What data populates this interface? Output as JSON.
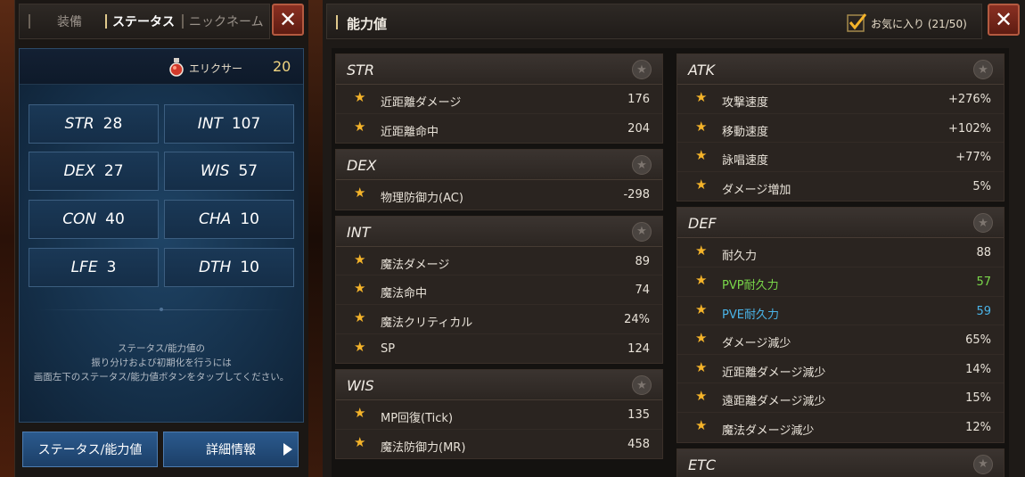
{
  "left": {
    "tabs": [
      {
        "label": "装備",
        "active": false
      },
      {
        "label": "ステータス",
        "active": true
      },
      {
        "label": "ニックネーム",
        "active": false
      }
    ],
    "close_label": "✕",
    "elixir": {
      "label": "エリクサー",
      "value": "20"
    },
    "stats": [
      {
        "name": "STR",
        "value": "28"
      },
      {
        "name": "INT",
        "value": "107"
      },
      {
        "name": "DEX",
        "value": "27"
      },
      {
        "name": "WIS",
        "value": "57"
      },
      {
        "name": "CON",
        "value": "40"
      },
      {
        "name": "CHA",
        "value": "10"
      },
      {
        "name": "LFE",
        "value": "3"
      },
      {
        "name": "DTH",
        "value": "10"
      }
    ],
    "note": [
      "ステータス/能力値の",
      "振り分けおよび初期化を行うには",
      "画面左下のステータス/能力値ボタンをタップしてください。"
    ],
    "buttons": {
      "status": "ステータス/能力値",
      "detail": "詳細情報"
    }
  },
  "right": {
    "title": "能力値",
    "favorite": "お気に入り (21/50)",
    "close_label": "✕",
    "colors": {
      "star": "#f5b42a",
      "pvp": "#7ad84a",
      "pve": "#4ab4e8"
    },
    "groups_left": [
      {
        "name": "STR",
        "rows": [
          {
            "label": "近距離ダメージ",
            "value": "176"
          },
          {
            "label": "近距離命中",
            "value": "204"
          }
        ]
      },
      {
        "name": "DEX",
        "rows": [
          {
            "label": "物理防御力(AC)",
            "value": "-298"
          }
        ]
      },
      {
        "name": "INT",
        "rows": [
          {
            "label": "魔法ダメージ",
            "value": "89"
          },
          {
            "label": "魔法命中",
            "value": "74"
          },
          {
            "label": "魔法クリティカル",
            "value": "24%"
          },
          {
            "label": "SP",
            "value": "124"
          }
        ]
      },
      {
        "name": "WIS",
        "rows": [
          {
            "label": "MP回復(Tick)",
            "value": "135"
          },
          {
            "label": "魔法防御力(MR)",
            "value": "458"
          }
        ]
      }
    ],
    "groups_right": [
      {
        "name": "ATK",
        "rows": [
          {
            "label": "攻撃速度",
            "value": "+276%"
          },
          {
            "label": "移動速度",
            "value": "+102%"
          },
          {
            "label": "詠唱速度",
            "value": "+77%"
          },
          {
            "label": "ダメージ増加",
            "value": "5%"
          }
        ]
      },
      {
        "name": "DEF",
        "rows": [
          {
            "label": "耐久力",
            "value": "88"
          },
          {
            "label": "PVP耐久力",
            "value": "57",
            "color": "green"
          },
          {
            "label": "PVE耐久力",
            "value": "59",
            "color": "blue"
          },
          {
            "label": "ダメージ減少",
            "value": "65%"
          },
          {
            "label": "近距離ダメージ減少",
            "value": "14%"
          },
          {
            "label": "遠距離ダメージ減少",
            "value": "15%"
          },
          {
            "label": "魔法ダメージ減少",
            "value": "12%"
          }
        ]
      },
      {
        "name": "ETC",
        "rows": []
      }
    ]
  }
}
